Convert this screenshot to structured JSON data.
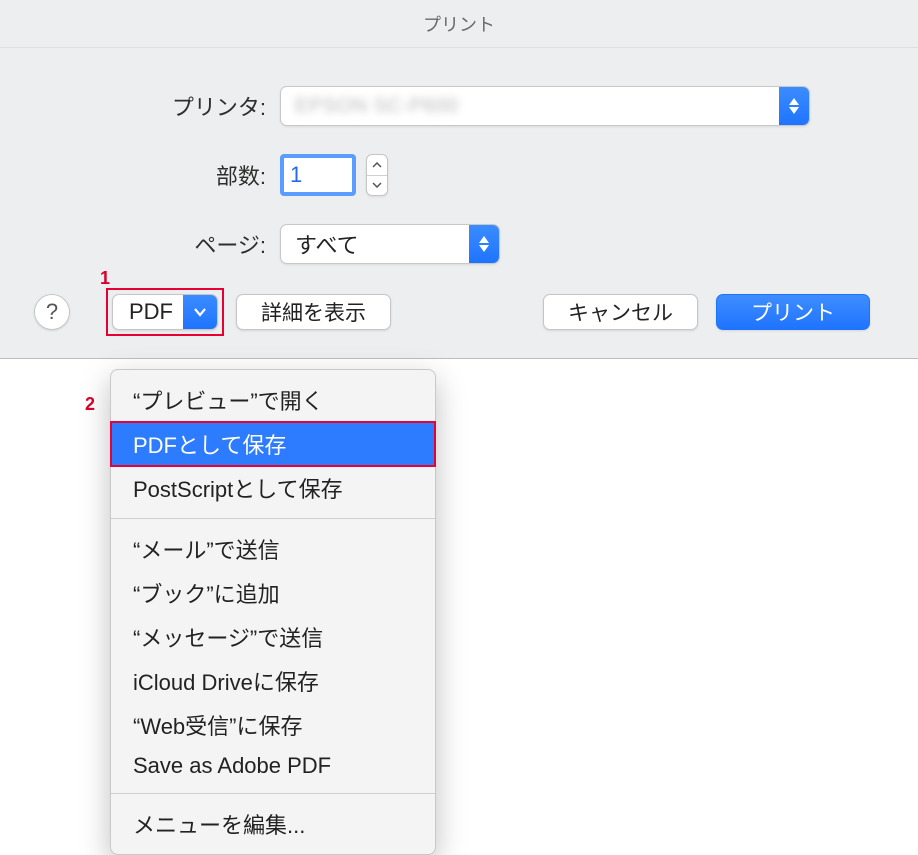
{
  "window_title": "プリント",
  "labels": {
    "printer": "プリンタ:",
    "copies": "部数:",
    "pages": "ページ:"
  },
  "printer_value": "EPSON SC-P600",
  "copies_value": "1",
  "pages_value": "すべて",
  "buttons": {
    "pdf": "PDF",
    "details": "詳細を表示",
    "cancel": "キャンセル",
    "print": "プリント",
    "help": "?"
  },
  "annotations": {
    "one": "1",
    "two": "2"
  },
  "menu": {
    "items": [
      "“プレビュー”で開く",
      "PDFとして保存",
      "PostScriptとして保存"
    ],
    "items2": [
      "“メール”で送信",
      "“ブック”に追加",
      "“メッセージ”で送信",
      "iCloud Driveに保存",
      "“Web受信”に保存",
      "Save as Adobe PDF"
    ],
    "edit": "メニューを編集..."
  }
}
